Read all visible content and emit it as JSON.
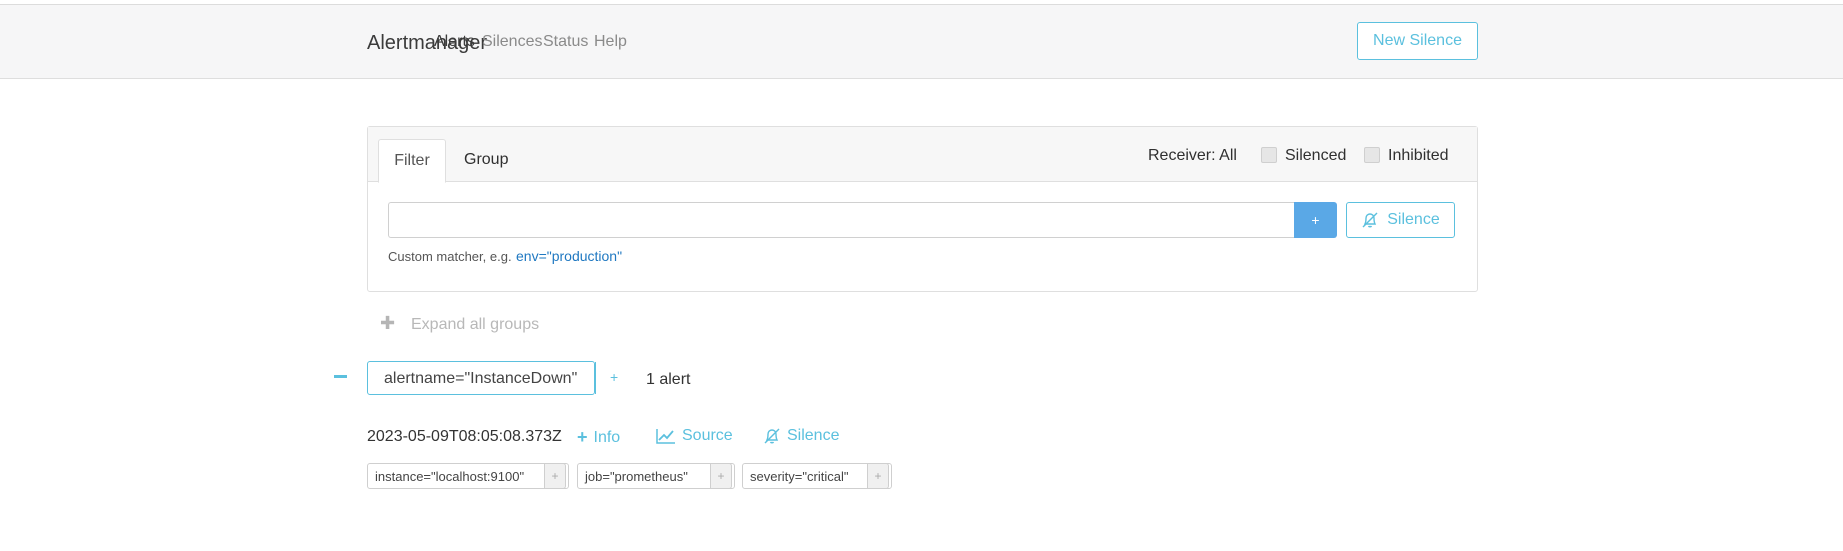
{
  "nav": {
    "brand": "Alertmanager",
    "links": [
      "Alerts",
      "Silences",
      "Status",
      "Help"
    ],
    "new_silence_label": "New Silence"
  },
  "filter_panel": {
    "tabs": [
      "Filter",
      "Group"
    ],
    "receiver_label": "Receiver: All",
    "silenced_label": "Silenced",
    "inhibited_label": "Inhibited",
    "add_button_label": "+",
    "silence_button_label": "Silence",
    "hint_text": "Custom matcher, e.g.",
    "hint_example": "env=\"production\"",
    "input_value": ""
  },
  "groups": {
    "expand_all_label": "Expand all groups",
    "group": {
      "matcher": "alertname=\"InstanceDown\"",
      "plus_label": "+",
      "count_label": "1 alert",
      "alerts": [
        {
          "timestamp": "2023-05-09T08:05:08.373Z",
          "info_label": "Info",
          "source_label": "Source",
          "silence_label": "Silence",
          "labels": [
            "instance=\"localhost:9100\"",
            "job=\"prometheus\"",
            "severity=\"critical\""
          ],
          "label_plus": "+"
        }
      ]
    }
  },
  "colors": {
    "accent": "#5bc0de",
    "primary": "#5aa8e6",
    "link": "#1f78c1"
  }
}
